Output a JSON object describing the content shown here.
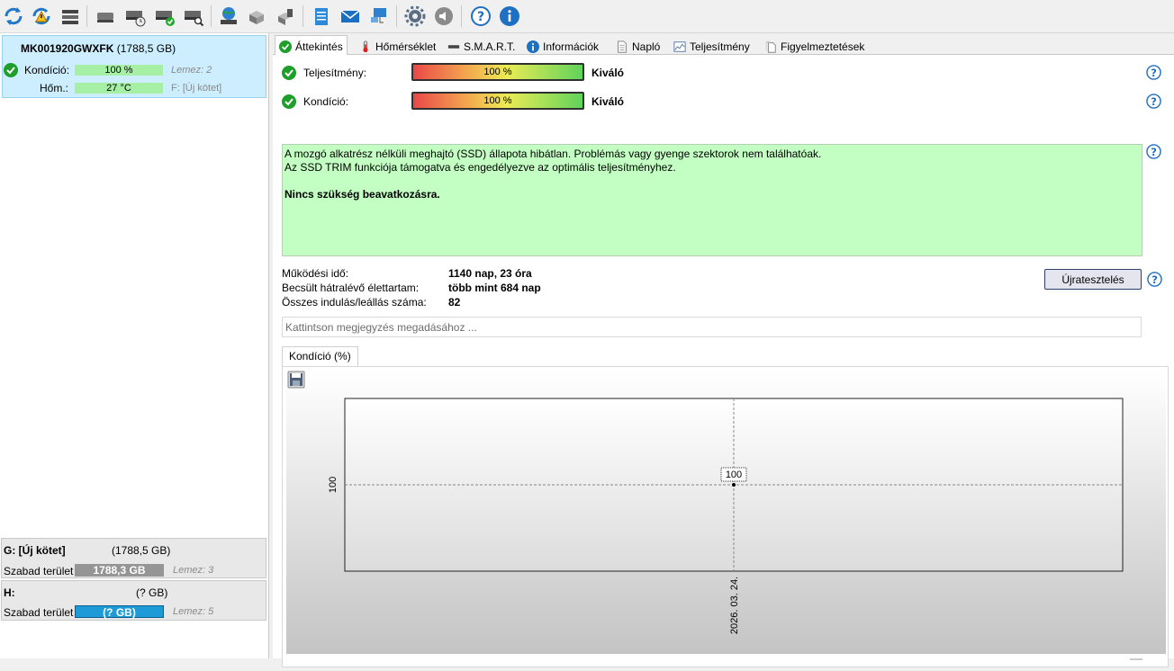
{
  "disk": {
    "name": "MK001920GWXFK",
    "size": "(1788,5 GB)",
    "condition_label": "Kondíció:",
    "condition_value": "100 %",
    "condition_disks": "Lemez: 2",
    "temp_label": "Hőm.:",
    "temp_value": "27 °C",
    "temp_volume": "F: [Új kötet]"
  },
  "volumes": [
    {
      "name": "G: [Új kötet]",
      "size": "(1788,5 GB)",
      "free_label": "Szabad terület",
      "free_value": "1788,3 GB",
      "disk": "Lemez: 3"
    },
    {
      "name": "H:",
      "size": "(? GB)",
      "free_label": "Szabad terület",
      "free_value": "(? GB)",
      "disk": "Lemez: 5"
    }
  ],
  "tabs": [
    "Áttekintés",
    "Hőmérséklet",
    "S.M.A.R.T.",
    "Információk",
    "Napló",
    "Teljesítmény",
    "Figyelmeztetések"
  ],
  "overview": {
    "performance_label": "Teljesítmény:",
    "performance_value": "100 %",
    "performance_rating": "Kiváló",
    "condition_label": "Kondíció:",
    "condition_value": "100 %",
    "condition_rating": "Kiváló",
    "message_line1": "A mozgó alkatrész nélküli meghajtó (SSD) állapota hibátlan. Problémás vagy gyenge szektorok nem találhatóak.",
    "message_line2": "Az SSD TRIM funkciója támogatva és engedélyezve az optimális teljesítményhez.",
    "message_bold": "Nincs szükség beavatkozásra.",
    "uptime_label": "Működési idő:",
    "uptime_value": "1140 nap, 23 óra",
    "lifetime_label": "Becsült hátralévő élettartam:",
    "lifetime_value": "több mint 684 nap",
    "starts_label": "Összes indulás/leállás száma:",
    "starts_value": "82",
    "retest_button": "Újratesztelés",
    "note_placeholder": "Kattintson megjegyzés megadásához ..."
  },
  "chart_tab": "Kondíció  (%)",
  "chart_data": {
    "type": "line",
    "x": [
      "2026. 03. 24."
    ],
    "values": [
      100
    ],
    "data_labels": [
      "100"
    ],
    "y_tick_labels": [
      "100"
    ]
  }
}
